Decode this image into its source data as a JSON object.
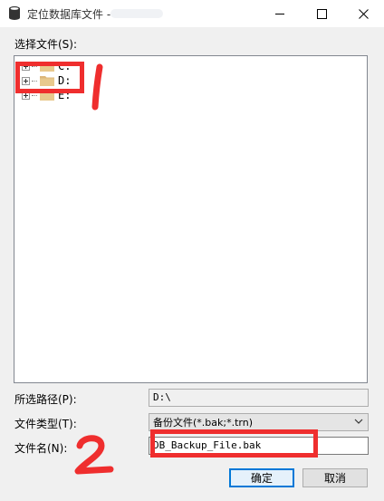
{
  "window": {
    "title": "定位数据库文件 -",
    "controls": [
      "minimize",
      "maximize",
      "close"
    ]
  },
  "select_label": "选择文件(S):",
  "tree": {
    "nodes": [
      {
        "label": "C:",
        "icon": "folder-icon"
      },
      {
        "label": "D:",
        "icon": "folder-icon"
      },
      {
        "label": "E:",
        "icon": "folder-icon"
      }
    ]
  },
  "fields": {
    "path_label": "所选路径(P):",
    "path_value": "D:\\",
    "type_label": "文件类型(T):",
    "type_value": "备份文件(*.bak;*.trn)",
    "name_label": "文件名(N):",
    "name_value": "DB_Backup_File.bak"
  },
  "buttons": {
    "ok": "确定",
    "cancel": "取消"
  },
  "annotations": {
    "marker_1": "1",
    "marker_2": "2",
    "color": "#ef2e2e"
  }
}
